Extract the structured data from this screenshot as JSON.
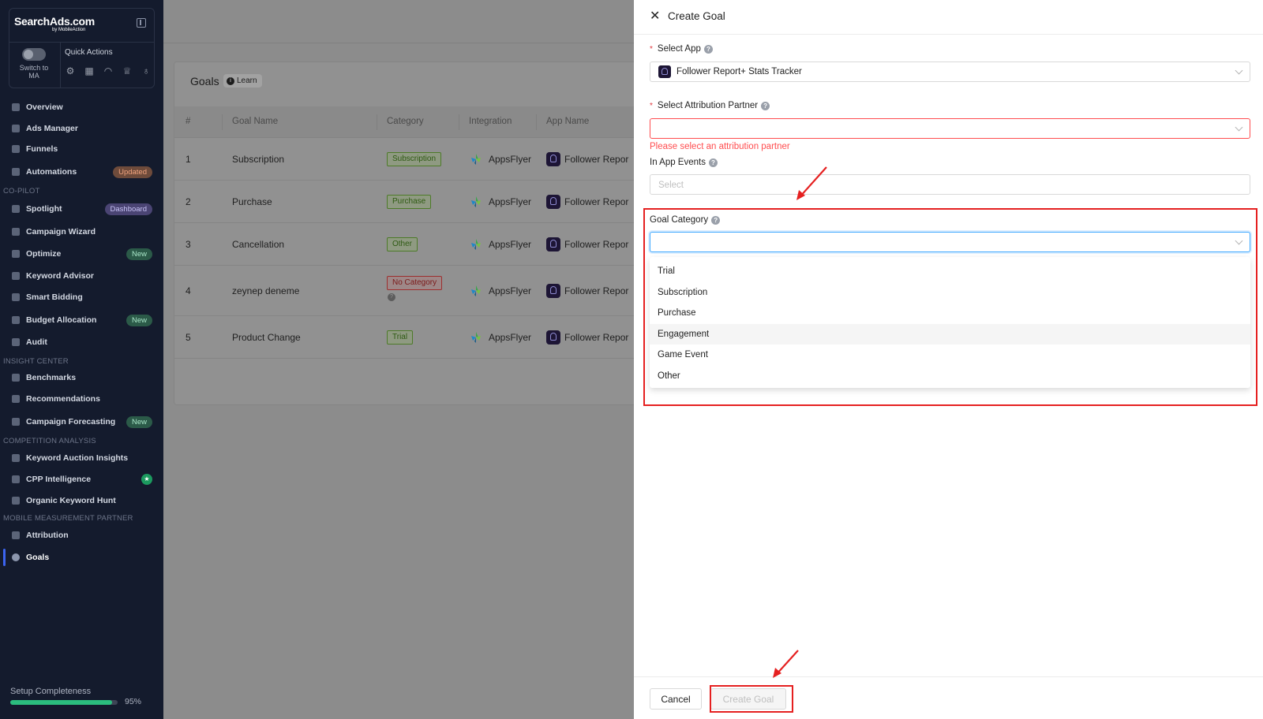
{
  "sidebar": {
    "logo": "SearchAds.com",
    "logo_sub": "by MobileAction",
    "switch_label": "Switch to MA",
    "quick_actions_title": "Quick Actions",
    "quick_action_icons": [
      "settings-icon",
      "calendar-icon",
      "headset-icon",
      "trophy-icon",
      "bulb-icon"
    ],
    "nav": [
      {
        "label": "Overview",
        "icon": "home-icon"
      },
      {
        "label": "Ads Manager",
        "icon": "grid-icon"
      },
      {
        "label": "Funnels",
        "icon": "funnel-icon"
      },
      {
        "label": "Automations",
        "icon": "automation-icon",
        "badge": "Updated"
      }
    ],
    "section_copilot": "CO-PILOT",
    "copilot": [
      {
        "label": "Spotlight",
        "badge": "Dashboard"
      },
      {
        "label": "Campaign Wizard"
      },
      {
        "label": "Optimize",
        "badge": "New"
      },
      {
        "label": "Keyword Advisor"
      },
      {
        "label": "Smart Bidding"
      },
      {
        "label": "Budget Allocation",
        "badge": "New"
      },
      {
        "label": "Audit"
      }
    ],
    "section_insight": "INSIGHT CENTER",
    "insight": [
      {
        "label": "Benchmarks"
      },
      {
        "label": "Recommendations"
      },
      {
        "label": "Campaign Forecasting",
        "badge": "New"
      }
    ],
    "section_competition": "COMPETITION ANALYSIS",
    "competition": [
      {
        "label": "Keyword Auction Insights"
      },
      {
        "label": "CPP Intelligence"
      },
      {
        "label": "Organic Keyword Hunt"
      }
    ],
    "section_mmp": "MOBILE MEASUREMENT PARTNER",
    "mmp": [
      {
        "label": "Attribution"
      },
      {
        "label": "Goals"
      }
    ],
    "setup_title": "Setup Completeness",
    "setup_pct": "95%",
    "setup_value": 0.95
  },
  "goals": {
    "title": "Goals",
    "learn": "Learn",
    "columns": [
      "#",
      "Goal Name",
      "Category",
      "Integration",
      "App Name"
    ],
    "rows": [
      {
        "num": "1",
        "name": "Subscription",
        "category": "Subscription",
        "integration": "AppsFlyer",
        "app": "Follower Repor"
      },
      {
        "num": "2",
        "name": "Purchase",
        "category": "Purchase",
        "integration": "AppsFlyer",
        "app": "Follower Repor"
      },
      {
        "num": "3",
        "name": "Cancellation",
        "category": "Other",
        "integration": "AppsFlyer",
        "app": "Follower Repor"
      },
      {
        "num": "4",
        "name": "zeynep deneme",
        "category": "No Category",
        "integration": "AppsFlyer",
        "app": "Follower Repor"
      },
      {
        "num": "5",
        "name": "Product Change",
        "category": "Trial",
        "integration": "AppsFlyer",
        "app": "Follower Repor"
      }
    ]
  },
  "drawer": {
    "title": "Create Goal",
    "select_app_label": "Select App",
    "select_app_value": "Follower Report+ Stats Tracker",
    "attribution_label": "Select Attribution Partner",
    "attribution_error": "Please select an attribution partner",
    "in_app_events_label": "In App Events",
    "in_app_events_placeholder": "Select",
    "goal_category_label": "Goal Category",
    "category_options": [
      "Trial",
      "Subscription",
      "Purchase",
      "Engagement",
      "Game Event",
      "Other"
    ],
    "hovered_option": "Engagement",
    "cancel": "Cancel",
    "create": "Create Goal"
  },
  "colors": {
    "sidebar_bg": "#141b2d",
    "annotation_red": "#e52020",
    "error_red": "#ff4d4f",
    "focus_blue": "#40a9ff",
    "progress_green": "#2bbd7e"
  }
}
